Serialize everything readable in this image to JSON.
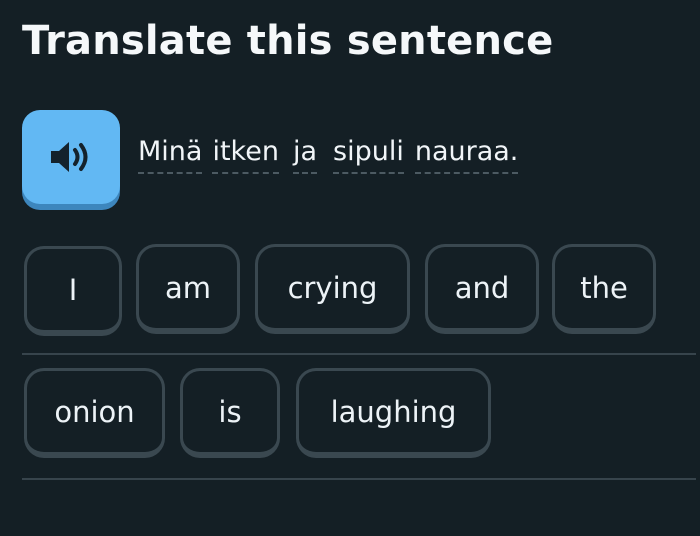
{
  "header": {
    "title": "Translate this sentence"
  },
  "prompt": {
    "audio_icon": "speaker-icon",
    "words": [
      "Minä",
      "itken",
      "ja",
      "sipuli",
      "nauraa."
    ]
  },
  "word_bank": {
    "row1": [
      "I",
      "am",
      "crying",
      "and",
      "the"
    ],
    "row2": [
      "onion",
      "is",
      "laughing"
    ]
  },
  "colors": {
    "background": "#141f25",
    "speaker_button": "#62b8f3",
    "speaker_shadow": "#3d86bd",
    "tile_border": "#3a4850",
    "text": "#f1f7fb"
  }
}
